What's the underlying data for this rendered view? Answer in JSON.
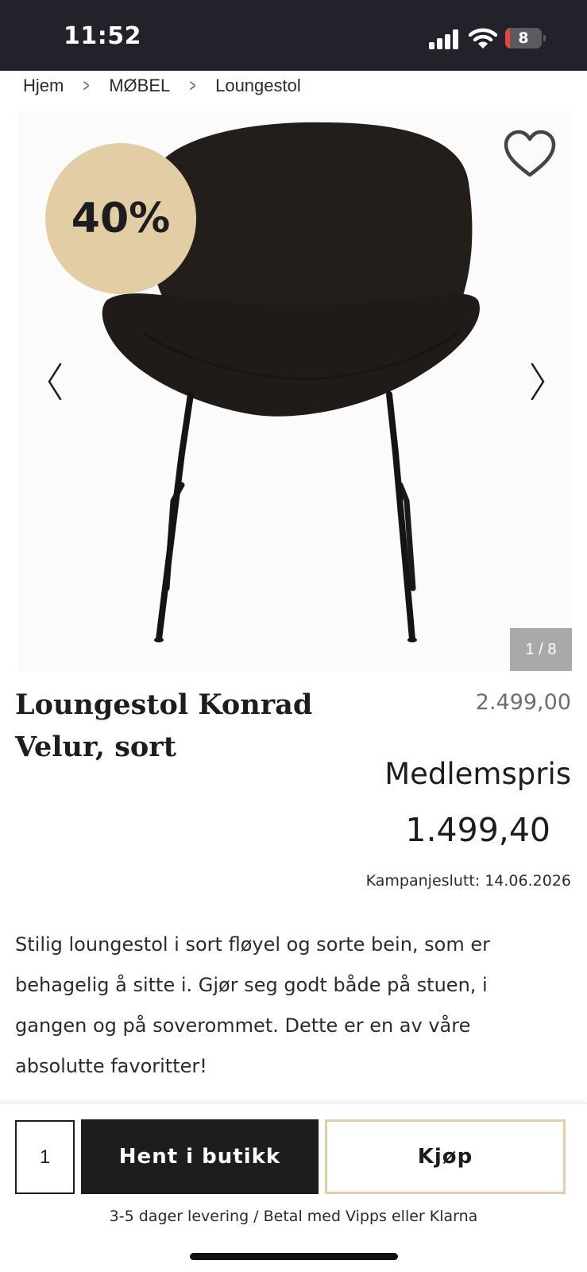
{
  "status_bar": {
    "time": "11:52",
    "battery_level": "8",
    "battery_fraction": 0.08,
    "icons": [
      "signal-icon",
      "wifi-icon",
      "battery-icon"
    ]
  },
  "breadcrumb": {
    "items": [
      "Hjem",
      "MØBEL",
      "Loungestol"
    ],
    "separator_icon": "chevron-right-icon"
  },
  "gallery": {
    "discount": "40%",
    "counter": "1 / 8",
    "favorite_icon": "heart-outline-icon",
    "prev_icon": "chevron-left-icon",
    "next_icon": "chevron-right-icon"
  },
  "product": {
    "title": "Loungestol Konrad Velur, sort",
    "old_price": "2.499,00",
    "member_label": "Medlemspris",
    "member_price": "1.499,40",
    "campaign_end": "Kampanjeslutt: 14.06.2026",
    "description": "Stilig loungestol i sort fløyel og sorte bein, som er behagelig å sitte i. Gjør seg godt både på stuen, i gangen og på soverommet. Dette er en av våre absolutte favoritter!"
  },
  "actions": {
    "quantity": "1",
    "pickup_label": "Hent i butikk",
    "buy_label": "Kjøp",
    "delivery_info": "3-5 dager levering / Betal med Vipps eller Klarna"
  },
  "colors": {
    "status_bar_bg": "#22232a",
    "badge_bg": "#e2cda4",
    "primary_button_bg": "#1d1d1d",
    "buy_border": "#e2cda4",
    "counter_bg": "#a9a9a9"
  }
}
